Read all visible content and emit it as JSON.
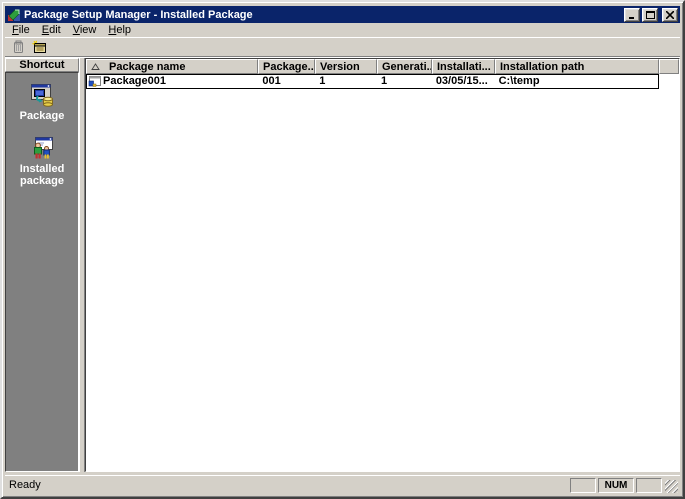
{
  "colors": {
    "titlebar": "#0a246a",
    "chrome": "#d4d0c8",
    "sidebar_bg": "#808080",
    "row_focus_border": "#000000"
  },
  "window": {
    "title": "Package Setup Manager - Installed Package",
    "app_icon": "package-manager-app-icon",
    "buttons": [
      "minimize-button",
      "maximize-button",
      "close-button"
    ]
  },
  "menu": {
    "items": [
      {
        "label": "File"
      },
      {
        "label": "Edit"
      },
      {
        "label": "View"
      },
      {
        "label": "Help"
      }
    ]
  },
  "toolbar": {
    "icons": [
      {
        "name": "package-tool-icon"
      },
      {
        "name": "properties-tool-icon"
      }
    ]
  },
  "sidebar": {
    "header": "Shortcut",
    "items": [
      {
        "label": "Package",
        "icon": "package-shortcut-icon"
      },
      {
        "label": "Installed package",
        "icon": "installed-package-shortcut-icon"
      }
    ]
  },
  "list": {
    "sort_icon": "sort-ascending-icon",
    "columns": [
      {
        "label": "Package name"
      },
      {
        "label": "Package..."
      },
      {
        "label": "Version"
      },
      {
        "label": "Generati..."
      },
      {
        "label": "Installati..."
      },
      {
        "label": "Installation path"
      }
    ],
    "rows": [
      {
        "icon": "package-item-icon",
        "cells": [
          "Package001",
          "001",
          "1",
          "1",
          "03/05/15...",
          "C:\\temp"
        ]
      }
    ]
  },
  "statusbar": {
    "ready": "Ready",
    "num": "NUM"
  }
}
